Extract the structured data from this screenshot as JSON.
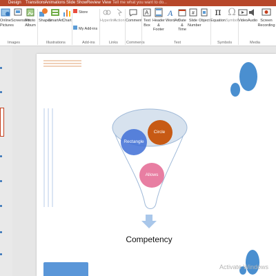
{
  "tabs": {
    "design": "Design",
    "transitions": "Transitions",
    "animations": "Animations",
    "slide_show": "Slide Show",
    "review": "Review",
    "view": "View",
    "tell_me": "Tell me what you want to do..."
  },
  "ribbon": {
    "images": {
      "online_pictures": "Online\nPictures",
      "screenshot": "Screenshot",
      "photo_album": "Photo\nAlbum",
      "label": "Images"
    },
    "illustrations": {
      "shapes": "Shapes",
      "smartart": "SmartArt",
      "chart": "Chart",
      "label": "Illustrations"
    },
    "addins": {
      "store": "Store",
      "my_addins": "My Add-ins",
      "label": "Add-ins"
    },
    "links": {
      "hyperlink": "Hyperlink",
      "action": "Action",
      "label": "Links"
    },
    "comments": {
      "comment": "Comment",
      "label": "Comments"
    },
    "text": {
      "text_box": "Text\nBox",
      "header_footer": "Header\n& Footer",
      "wordart": "WordArt",
      "date_time": "Date &\nTime",
      "slide_number": "Slide\nNumber",
      "object": "Object",
      "label": "Text"
    },
    "symbols": {
      "equation": "Equation",
      "symbol": "Symbol",
      "label": "Symbols"
    },
    "media": {
      "video": "Video",
      "audio": "Audio",
      "screen_recording": "Screen\nRecording",
      "label": "Media"
    }
  },
  "slide": {
    "circle_label": "Circle",
    "rectangle_label": "Rectangle",
    "allows_label": "Allows",
    "title": "Competency"
  },
  "watermark": "Activate Windows",
  "colors": {
    "ribbon_tab": "#b7472a",
    "blue": "#3f6fd6",
    "orange": "#c75a14",
    "pink": "#e87ea2",
    "accent_blue": "#4a8fd0"
  }
}
